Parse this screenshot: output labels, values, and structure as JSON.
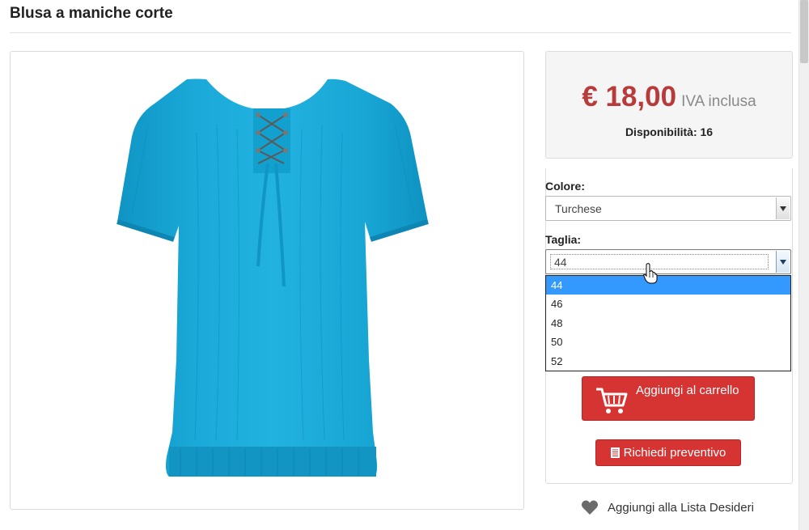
{
  "product": {
    "title": "Blusa a maniche corte",
    "image_alt": "turquoise short-sleeve blouse",
    "price": "€ 18,00",
    "vat_note": "IVA inclusa",
    "availability": "Disponibilità: 16"
  },
  "colors": {
    "price": "#b83b3b",
    "button": "#d63333",
    "selected_option": "#3399ff",
    "product": "#1aa7d6"
  },
  "options": {
    "color_label": "Colore:",
    "color_value": "Turchese",
    "size_label": "Taglia:",
    "size_value": "44",
    "size_options": [
      "44",
      "46",
      "48",
      "50",
      "52"
    ],
    "size_selected_index": 0
  },
  "actions": {
    "add_to_cart": "Aggiungi al carrello",
    "request_quote": "Richiedi preventivo",
    "wishlist": "Aggiungi alla Lista Desideri"
  },
  "icons": {
    "cart": "shopping-cart-icon",
    "quote": "document-icon",
    "wishlist": "heart-icon",
    "dropdown": "chevron-down-icon",
    "cursor": "hand-pointer-icon"
  }
}
